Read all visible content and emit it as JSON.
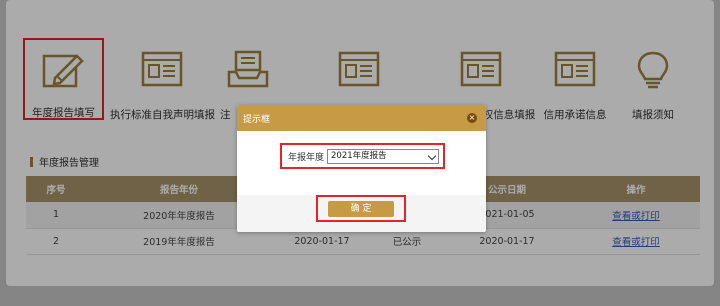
{
  "nav": {
    "items": [
      {
        "label": "年度报告填写",
        "icon": "pencil-edit-icon"
      },
      {
        "label": "执行标准自我声明填报",
        "icon": "form-list-icon"
      },
      {
        "label": "注",
        "icon": "inbox-tray-icon"
      },
      {
        "label": "",
        "icon": "form-list-icon"
      },
      {
        "label": "权信息填报",
        "icon": "form-list-icon"
      },
      {
        "label": "信用承诺信息",
        "icon": "form-list-icon"
      },
      {
        "label": "填报须知",
        "icon": "lightbulb-icon"
      }
    ]
  },
  "section": {
    "title": "年度报告管理"
  },
  "table": {
    "headers": [
      "序号",
      "报告年份",
      "",
      "",
      "公示日期",
      "操作"
    ],
    "rows": [
      {
        "index": "1",
        "year": "2020年年度报告",
        "date": "",
        "status": "",
        "publish_date": "2021-01-05",
        "action": "查看或打印"
      },
      {
        "index": "2",
        "year": "2019年年度报告",
        "date": "2020-01-17",
        "status": "已公示",
        "publish_date": "2020-01-17",
        "action": "查看或打印"
      }
    ]
  },
  "dialog": {
    "title": "提示框",
    "close": "×",
    "field_label": "年报年度",
    "select_value": "2021年度报告",
    "confirm": "确 定"
  },
  "colors": {
    "accent": "#c79b45",
    "table_header": "#a8936b",
    "highlight": "#e0252b",
    "icon": "#9c7f3f"
  }
}
